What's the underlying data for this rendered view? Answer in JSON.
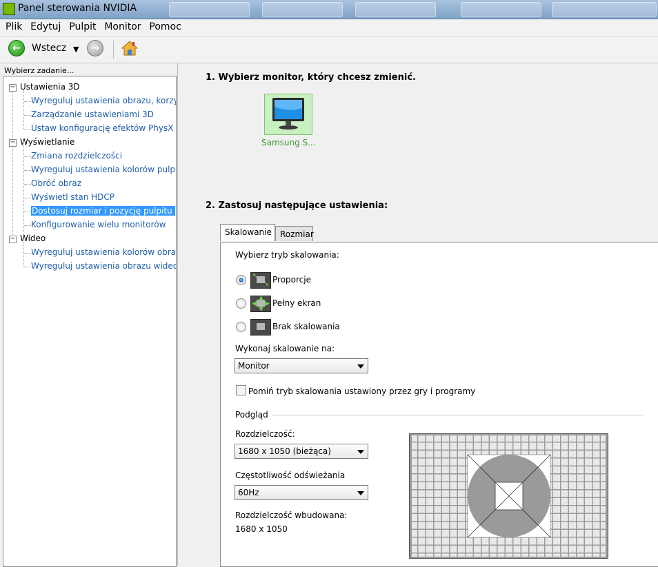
{
  "window": {
    "title": "Panel sterowania NVIDIA"
  },
  "menu": [
    "Plik",
    "Edytuj",
    "Pulpit",
    "Monitor",
    "Pomoc"
  ],
  "toolbar": {
    "back_label": "Wstecz"
  },
  "sidebar": {
    "title": "Wybierz zadanie...",
    "groups": [
      {
        "label": "Ustawienia 3D",
        "items": [
          "Wyreguluj ustawienia obrazu, korzys",
          "Zarządzanie ustawieniami 3D",
          "Ustaw konfigurację efektów PhysX"
        ]
      },
      {
        "label": "Wyświetlanie",
        "items": [
          "Zmiana rozdzielczości",
          "Wyreguluj ustawienia kolorów pulpit",
          "Obróć obraz",
          "Wyświetl stan HDCP",
          "Dostosuj rozmiar i pozycję pulpitu",
          "Konfigurowanie wielu monitorów"
        ]
      },
      {
        "label": "Wideo",
        "items": [
          "Wyreguluj ustawienia kolorów obraz",
          "Wyreguluj ustawienia obrazu wideo"
        ]
      }
    ],
    "selected": "Dostosuj rozmiar i pozycję pulpitu"
  },
  "main": {
    "step1": "1. Wybierz monitor, który chcesz zmienić.",
    "monitor_label": "Samsung S...",
    "step2": "2. Zastosuj następujące ustawienia:",
    "tabs": [
      "Skalowanie",
      "Rozmiar"
    ],
    "scaling": {
      "mode_label": "Wybierz tryb skalowania:",
      "options": [
        "Proporcje",
        "Pełny ekran",
        "Brak skalowania"
      ],
      "selected_option": "Proporcje",
      "perform_label": "Wykonaj skalowanie na:",
      "perform_value": "Monitor",
      "override_label": "Pomiń tryb skalowania ustawiony przez gry i programy",
      "override_checked": false
    },
    "preview": {
      "group_label": "Podgląd",
      "resolution_label": "Rozdzielczość:",
      "resolution_value": "1680 x 1050 (bieżąca)",
      "refresh_label": "Częstotliwość odświeżania",
      "refresh_value": "60Hz",
      "native_label": "Rozdzielczość wbudowana:",
      "native_value": "1680 x 1050"
    }
  }
}
